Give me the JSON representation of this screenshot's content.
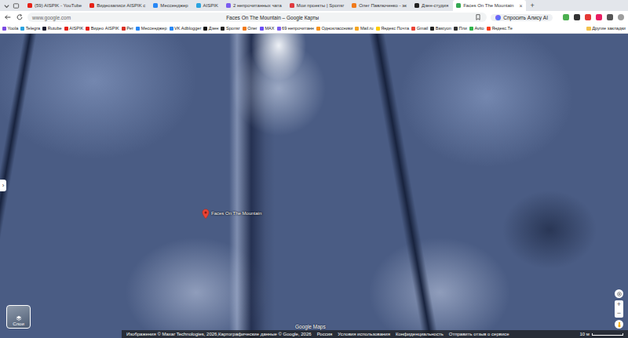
{
  "tabs": [
    {
      "label": "(59) AISPIK - YouTube",
      "selected": false,
      "color": "#e62117"
    },
    {
      "label": "Видеозаписи AISPIK с",
      "selected": false,
      "color": "#e62117"
    },
    {
      "label": "Мессенджер",
      "selected": false,
      "color": "#2787f5"
    },
    {
      "label": "AISPIK",
      "selected": false,
      "color": "#2aa3e0"
    },
    {
      "label": "2 непрочитанных чата",
      "selected": false,
      "color": "#7b5cf0"
    },
    {
      "label": "Мои проекты | Sponsr",
      "selected": false,
      "color": "#e0393e"
    },
    {
      "label": "Олег Павлюченко - эк",
      "selected": false,
      "color": "#f07a1a"
    },
    {
      "label": "Дзен-студия",
      "selected": false,
      "color": "#222222"
    },
    {
      "label": "Faces On The Mountain",
      "selected": true,
      "color": "#34a853"
    }
  ],
  "close_tab": "×",
  "new_tab": "+",
  "address_bar": {
    "url": "www.google.com",
    "page_title": "Faces On The Mountain – Google Карты",
    "alice_button": "Спросить Алису AI"
  },
  "bookmarks": [
    {
      "label": "Yoola",
      "color": "#7b4ae2"
    },
    {
      "label": "Telegra",
      "color": "#2aa3e0"
    },
    {
      "label": "Rutube",
      "color": "#1b1b2f"
    },
    {
      "label": "AISPIK",
      "color": "#e62117"
    },
    {
      "label": "Видео AISPIK",
      "color": "#e62117"
    },
    {
      "label": "Рет",
      "color": "#d93025"
    },
    {
      "label": "Мессенджер",
      "color": "#2787f5"
    },
    {
      "label": "VK Adblogger",
      "color": "#2787f5"
    },
    {
      "label": "Дзен",
      "color": "#111111"
    },
    {
      "label": "Sponsr",
      "color": "#222222"
    },
    {
      "label": "Олег",
      "color": "#f07a1a"
    },
    {
      "label": "MAX",
      "color": "#6a4cf5"
    },
    {
      "label": "69 непрочитанн",
      "color": "#7b5cf0"
    },
    {
      "label": "Одноклассники",
      "color": "#f7931e"
    },
    {
      "label": "Mail.ru",
      "color": "#f5a623"
    },
    {
      "label": "Яндекс Почта",
      "color": "#ffcc00"
    },
    {
      "label": "Gmail",
      "color": "#ea4335"
    },
    {
      "label": "Bastyon",
      "color": "#222222"
    },
    {
      "label": "Пли",
      "color": "#333333"
    },
    {
      "label": "Avito",
      "color": "#2fb34a"
    },
    {
      "label": "Яндекс.Те",
      "color": "#fc3f1d"
    }
  ],
  "other_bookmarks": "Другие закладки",
  "map": {
    "pin_label": "Faces On The Mountain",
    "side_toggle": "›",
    "layers_button": "Слои",
    "watermark": "Google Maps",
    "zoom_in": "+",
    "zoom_out": "−"
  },
  "footer": {
    "attribution": "Изображения © Maxar Technologies, 2026,Картографические данные © Google, 2026",
    "links": [
      "Россия",
      "Условия использования",
      "Конфиденциальность",
      "Отправить отзыв о сервисе"
    ],
    "scale": "10 м"
  }
}
